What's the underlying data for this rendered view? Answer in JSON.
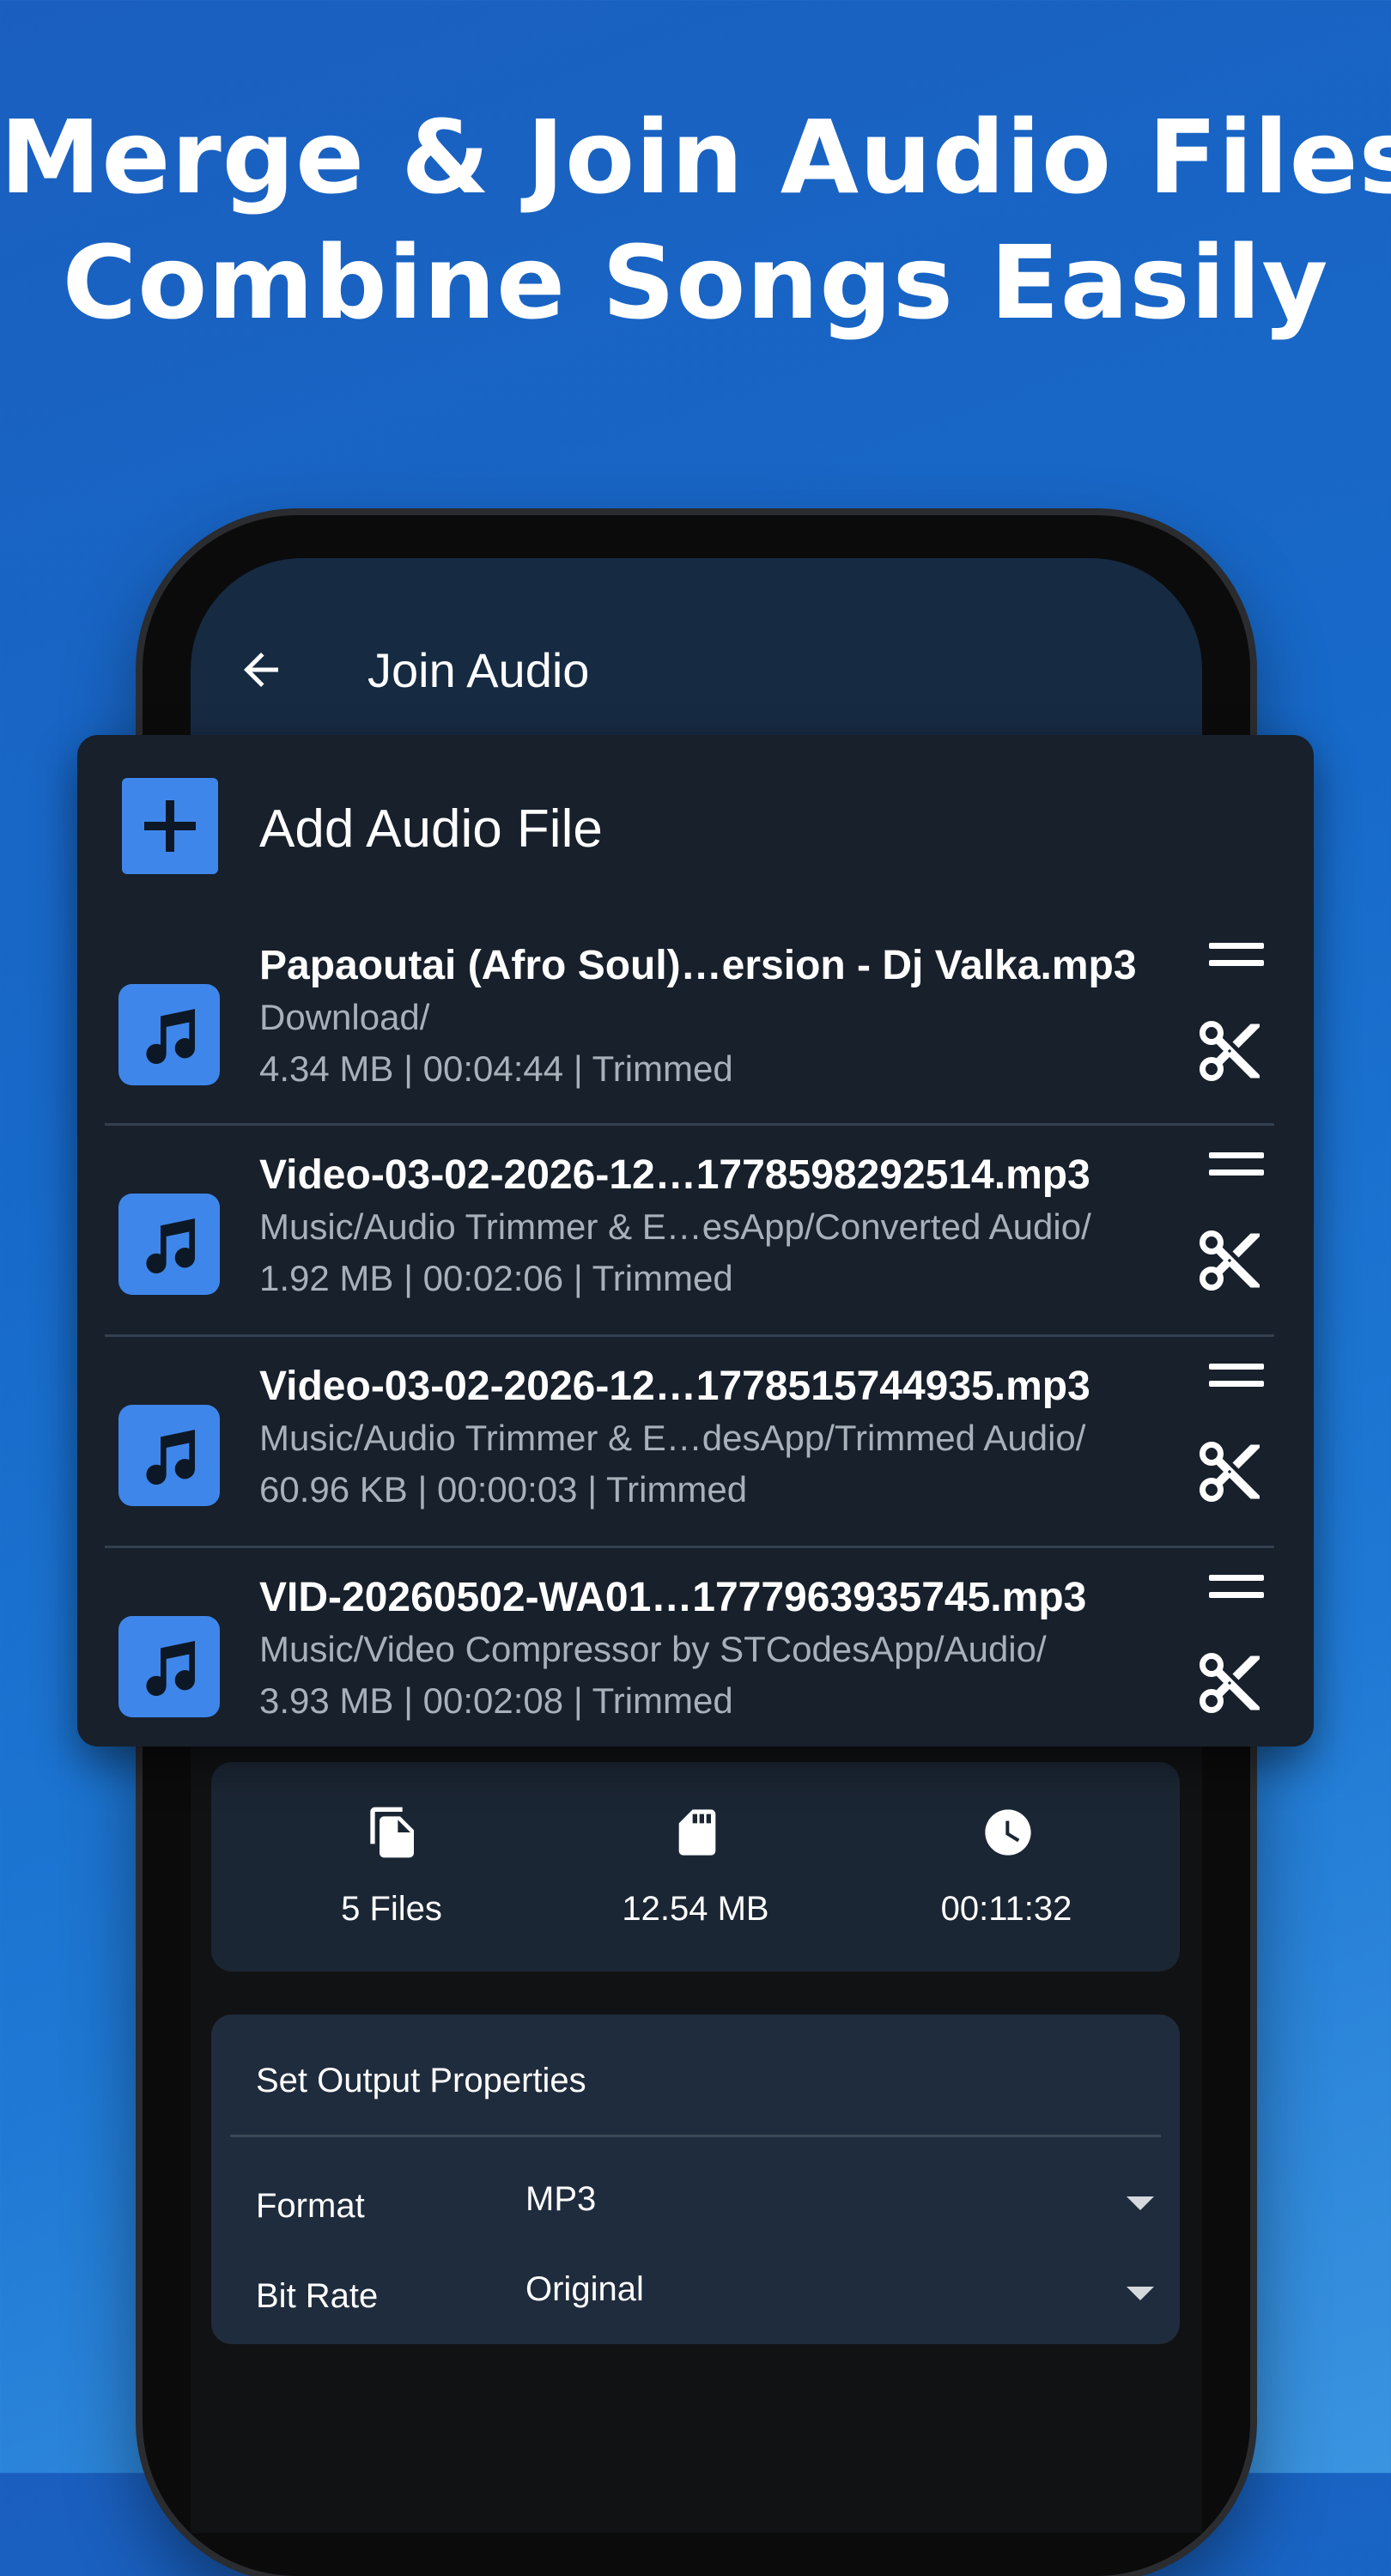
{
  "headline": {
    "line1": "Merge & Join Audio Files",
    "line2": "Combine Songs Easily"
  },
  "appbar": {
    "back_icon": "arrow-left-icon",
    "title": "Join Audio"
  },
  "add_file": {
    "icon": "plus-icon",
    "label": "Add Audio File"
  },
  "files": [
    {
      "name": "Papaoutai (Afro Soul)…ersion - Dj Valka.mp3",
      "path": "Download/",
      "meta": "4.34 MB | 00:04:44 | Trimmed"
    },
    {
      "name": "Video-03-02-2026-12…1778598292514.mp3",
      "path": "Music/Audio Trimmer & E…esApp/Converted Audio/",
      "meta": "1.92 MB | 00:02:06 | Trimmed"
    },
    {
      "name": "Video-03-02-2026-12…1778515744935.mp3",
      "path": "Music/Audio Trimmer & E…desApp/Trimmed Audio/",
      "meta": "60.96 KB | 00:00:03 | Trimmed"
    },
    {
      "name": "VID-20260502-WA01…1777963935745.mp3",
      "path": "Music/Video Compressor by STCodesApp/Audio/",
      "meta": "3.93 MB | 00:02:08 | Trimmed"
    }
  ],
  "stats": {
    "files": "5 Files",
    "size": "12.54 MB",
    "duration": "00:11:32"
  },
  "output": {
    "title": "Set Output Properties",
    "format_label": "Format",
    "format_value": "MP3",
    "bitrate_label": "Bit Rate",
    "bitrate_value": "Original"
  },
  "colors": {
    "accent": "#3f86ea",
    "appbar": "#162a42",
    "card": "#17202b",
    "panel": "#1f2c3d"
  }
}
